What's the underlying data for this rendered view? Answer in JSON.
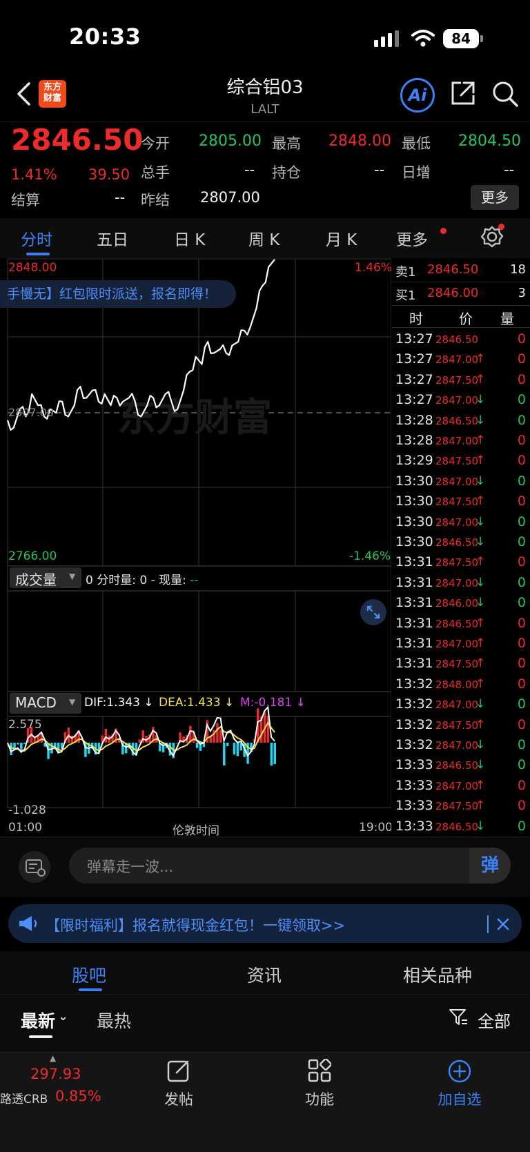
{
  "status_bar": {
    "time": "20:33",
    "battery": "84"
  },
  "header": {
    "title": "综合铝03",
    "subtitle": "LALT",
    "logo_line1": "东方",
    "logo_line2": "财富",
    "ai_label": "Ai"
  },
  "quote": {
    "price": "2846.50",
    "change_pct": "1.41%",
    "change": "39.50",
    "settle_label": "结算",
    "settle_value": "--",
    "prev_settle_label": "昨结",
    "prev_settle_value": "2807.00",
    "open_label": "今开",
    "open_value": "2805.00",
    "high_label": "最高",
    "high_value": "2848.00",
    "low_label": "最低",
    "low_value": "2804.50",
    "volume_label": "总手",
    "volume_value": "--",
    "oi_label": "持仓",
    "oi_value": "--",
    "day_inc_label": "日增",
    "day_inc_value": "--",
    "more_button": "更多"
  },
  "tabs": [
    "分时",
    "五日",
    "日 K",
    "周 K",
    "月 K",
    "更多"
  ],
  "chart": {
    "price_high_label": "2848.00",
    "price_low_label": "2766.00",
    "pct_high_label": "1.46%",
    "pct_low_label": "-1.46%",
    "prev_close_label": "2807.00",
    "promo": "手慢无】红包限时派送，报名即得！",
    "watermark": "东方财富",
    "volume_selector": "成交量",
    "volume_info_prefix": "0 分时量: 0 - 现量: ",
    "volume_info_dash": "--",
    "macd_selector": "MACD",
    "dif": "DIF:1.343 ↓",
    "dea": "DEA:1.433 ↓",
    "m": "M:-0.181 ↓",
    "macd_high": "2.575",
    "macd_low": "-1.028",
    "time_start": "01:00",
    "time_mid": "伦敦时间",
    "time_end": "19:00"
  },
  "chart_data": {
    "type": "line",
    "title": "",
    "ylim": [
      2766.0,
      2848.0
    ],
    "ref_line": 2807.0,
    "series": [
      {
        "values": [
          2805,
          2803,
          2808,
          2806,
          2812,
          2809,
          2806,
          2808,
          2807,
          2810,
          2806,
          2809,
          2814,
          2811,
          2813,
          2810,
          2812,
          2809,
          2811,
          2810,
          2811,
          2810,
          2806,
          2809,
          2811,
          2809,
          2812,
          2810,
          2808,
          2813,
          2818,
          2822,
          2820,
          2826,
          2823,
          2824,
          2823,
          2825,
          2826,
          2829,
          2830,
          2835,
          2841,
          2846,
          2848
        ]
      }
    ]
  },
  "order_book": {
    "sell_label": "卖1",
    "sell_price": "2846.50",
    "sell_qty": "18",
    "buy_label": "买1",
    "buy_price": "2846.00",
    "buy_qty": "3",
    "col_time": "时",
    "col_price": "价",
    "col_qty": "量"
  },
  "trades": [
    {
      "time": "13:27",
      "price": "2846.50",
      "arrow": "",
      "qty": "0",
      "up": true
    },
    {
      "time": "13:27",
      "price": "2847.00",
      "arrow": "↑",
      "qty": "0",
      "up": true
    },
    {
      "time": "13:27",
      "price": "2847.50",
      "arrow": "↑",
      "qty": "0",
      "up": true
    },
    {
      "time": "13:27",
      "price": "2847.00",
      "arrow": "↓",
      "qty": "0",
      "up": false
    },
    {
      "time": "13:28",
      "price": "2846.50",
      "arrow": "↓",
      "qty": "0",
      "up": false
    },
    {
      "time": "13:28",
      "price": "2847.00",
      "arrow": "↑",
      "qty": "0",
      "up": true
    },
    {
      "time": "13:29",
      "price": "2847.50",
      "arrow": "↑",
      "qty": "0",
      "up": true
    },
    {
      "time": "13:30",
      "price": "2847.00",
      "arrow": "↓",
      "qty": "0",
      "up": false
    },
    {
      "time": "13:30",
      "price": "2847.50",
      "arrow": "↑",
      "qty": "0",
      "up": true
    },
    {
      "time": "13:30",
      "price": "2847.00",
      "arrow": "↓",
      "qty": "0",
      "up": false
    },
    {
      "time": "13:30",
      "price": "2846.50",
      "arrow": "↓",
      "qty": "0",
      "up": false
    },
    {
      "time": "13:31",
      "price": "2847.50",
      "arrow": "↑",
      "qty": "0",
      "up": true
    },
    {
      "time": "13:31",
      "price": "2847.00",
      "arrow": "↓",
      "qty": "0",
      "up": false
    },
    {
      "time": "13:31",
      "price": "2846.00",
      "arrow": "↓",
      "qty": "0",
      "up": false
    },
    {
      "time": "13:31",
      "price": "2846.50",
      "arrow": "↑",
      "qty": "0",
      "up": true
    },
    {
      "time": "13:31",
      "price": "2847.00",
      "arrow": "↑",
      "qty": "0",
      "up": true
    },
    {
      "time": "13:31",
      "price": "2847.50",
      "arrow": "↑",
      "qty": "0",
      "up": true
    },
    {
      "time": "13:32",
      "price": "2848.00",
      "arrow": "↑",
      "qty": "0",
      "up": true
    },
    {
      "time": "13:32",
      "price": "2847.00",
      "arrow": "↓",
      "qty": "0",
      "up": false
    },
    {
      "time": "13:32",
      "price": "2847.50",
      "arrow": "↑",
      "qty": "0",
      "up": true
    },
    {
      "time": "13:32",
      "price": "2847.00",
      "arrow": "↓",
      "qty": "0",
      "up": false
    },
    {
      "time": "13:33",
      "price": "2846.50",
      "arrow": "↓",
      "qty": "0",
      "up": false
    },
    {
      "time": "13:33",
      "price": "2847.00",
      "arrow": "↑",
      "qty": "0",
      "up": true
    },
    {
      "time": "13:33",
      "price": "2847.50",
      "arrow": "↑",
      "qty": "0",
      "up": true
    },
    {
      "time": "13:33",
      "price": "2846.50",
      "arrow": "↓",
      "qty": "0",
      "up": false
    }
  ],
  "danmu": {
    "placeholder": "弹幕走一波...",
    "button": "弹"
  },
  "banner": {
    "text": "【限时福利】报名就得现金红包！一键领取>>"
  },
  "bottom_tabs": [
    "股吧",
    "资讯",
    "相关品种"
  ],
  "filters": {
    "latest": "最新",
    "hot": "最热",
    "all": "全部"
  },
  "bottom_bar": {
    "index_value": "297.93",
    "index_name": "路透CRB",
    "index_change": "0.85%",
    "post_label": "发帖",
    "func_label": "功能",
    "add_label": "加自选"
  },
  "colors": {
    "up": "#ee2b2b",
    "down": "#22c55e",
    "accent": "#3b82f6",
    "dif": "#ffffff",
    "dea": "#f5e24a",
    "m": "#d946ef"
  }
}
